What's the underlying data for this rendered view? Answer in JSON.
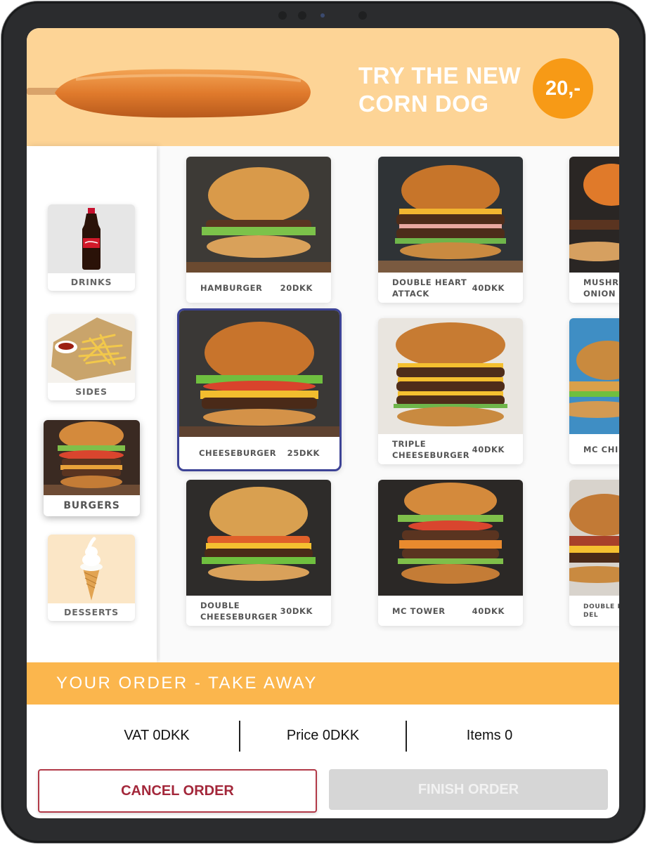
{
  "banner": {
    "title_line1": "TRY THE NEW",
    "title_line2": "CORN DOG",
    "price": "20,-"
  },
  "categories": [
    {
      "label": "DRINKS",
      "icon": "cola-bottle"
    },
    {
      "label": "SIDES",
      "icon": "fries"
    },
    {
      "label": "BURGERS",
      "icon": "burger",
      "selected": true
    },
    {
      "label": "DESSERTS",
      "icon": "soft-ice-cone"
    }
  ],
  "products": [
    {
      "name": "HAMBURGER",
      "price": "20DKK"
    },
    {
      "name": "DOUBLE HEART ATTACK",
      "price": "40DKK"
    },
    {
      "name": "MUSHROOM ONION B",
      "price": ""
    },
    {
      "name": "CHEESEBURGER",
      "price": "25DKK",
      "selected": true
    },
    {
      "name": "TRIPLE CHEESEBURGER",
      "price": "40DKK"
    },
    {
      "name": "MC CHI",
      "price": ""
    },
    {
      "name": "DOUBLE CHEESEBURGER",
      "price": "30DKK"
    },
    {
      "name": "MC TOWER",
      "price": "40DKK"
    },
    {
      "name": "DOUBLE BA CHEESE DEL",
      "price": ""
    }
  ],
  "order": {
    "title": "YOUR ORDER - TAKE AWAY",
    "vat": "VAT 0DKK",
    "price": "Price 0DKK",
    "items": "Items 0",
    "cancel_label": "CANCEL ORDER",
    "finish_label": "FINISH ORDER"
  },
  "colors": {
    "banner_bg": "#fdd496",
    "badge": "#f79a16",
    "order_bar": "#fbb64d",
    "selected_border": "#3d4396",
    "cancel": "#a3273a",
    "finish_disabled": "#d6d6d6"
  }
}
